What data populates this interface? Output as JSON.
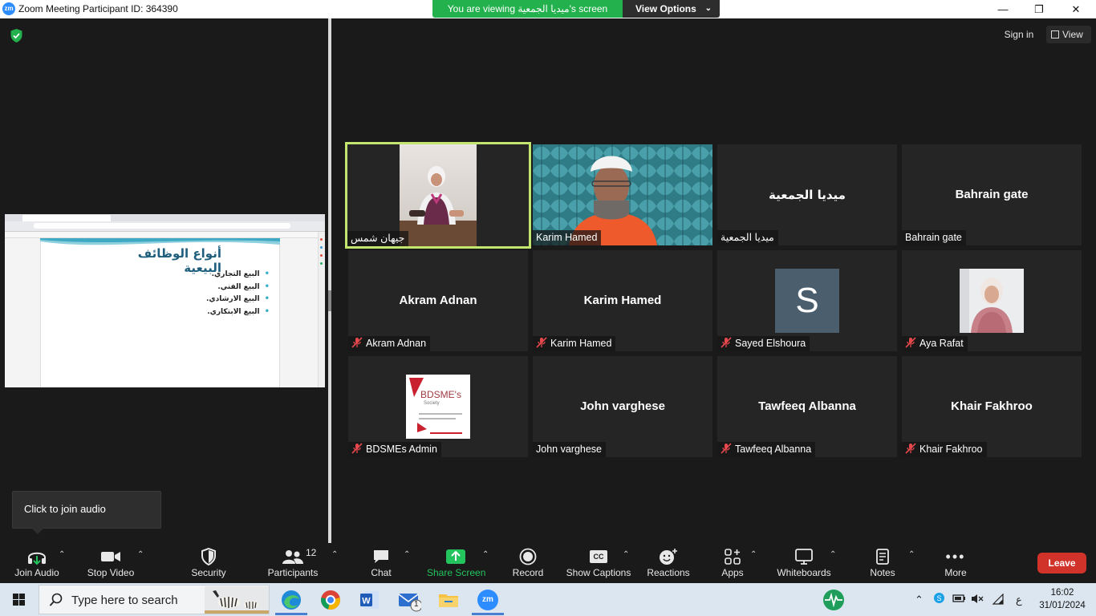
{
  "window": {
    "title": "Zoom Meeting Participant ID: 364390",
    "logo_text": "zm",
    "minimize": "—",
    "restore": "❐",
    "close": "✕"
  },
  "banner": {
    "viewing_text": "You are viewing ميديا الجمعية's screen",
    "view_options": "View Options"
  },
  "header": {
    "sign_in": "Sign in",
    "view": "View"
  },
  "shared_screen": {
    "slide_title": "أنواع الوظائف البيعية",
    "bullets": [
      "البيع التجاري.",
      "البيع الفني.",
      "البيع الارشادي.",
      "البيع الابتكاري."
    ]
  },
  "tiles": [
    {
      "name": "جيهان شمس",
      "display": "",
      "muted": false,
      "type": "video-woman",
      "active": true
    },
    {
      "name": "Karim Hamed",
      "display": "",
      "muted": false,
      "type": "video-man",
      "active": false
    },
    {
      "name": "ميديا الجمعية",
      "display": "ميديا الجمعية",
      "muted": false,
      "type": "name",
      "active": false
    },
    {
      "name": "Bahrain gate",
      "display": "Bahrain gate",
      "muted": false,
      "type": "name",
      "active": false
    },
    {
      "name": "Akram Adnan",
      "display": "Akram Adnan",
      "muted": true,
      "type": "name",
      "active": false
    },
    {
      "name": "Karim Hamed",
      "display": "Karim Hamed",
      "muted": true,
      "type": "name",
      "active": false
    },
    {
      "name": "Sayed Elshoura",
      "display": "S",
      "muted": true,
      "type": "avatar-letter",
      "active": false
    },
    {
      "name": "Aya Rafat",
      "display": "",
      "muted": true,
      "type": "avatar-photo",
      "active": false
    },
    {
      "name": "BDSMEs Admin",
      "display": "",
      "muted": true,
      "type": "avatar-logo",
      "active": false,
      "logo_text": "BDSME's",
      "logo_sub": "Society"
    },
    {
      "name": "John varghese",
      "display": "John varghese",
      "muted": false,
      "type": "name",
      "active": false
    },
    {
      "name": "Tawfeeq Albanna",
      "display": "Tawfeeq Albanna",
      "muted": true,
      "type": "name",
      "active": false
    },
    {
      "name": "Khair Fakhroo",
      "display": "Khair Fakhroo",
      "muted": true,
      "type": "name",
      "active": false
    }
  ],
  "tooltip": "Click to join audio",
  "toolbar": {
    "join_audio": "Join Audio",
    "stop_video": "Stop Video",
    "security": "Security",
    "participants": "Participants",
    "participants_count": "12",
    "chat": "Chat",
    "share_screen": "Share Screen",
    "record": "Record",
    "show_captions": "Show Captions",
    "captions_icon_text": "CC",
    "reactions": "Reactions",
    "apps": "Apps",
    "whiteboards": "Whiteboards",
    "notes": "Notes",
    "more": "More",
    "leave": "Leave"
  },
  "taskbar": {
    "search_placeholder": "Type here to search",
    "zoom_label": "zm",
    "mail_badge": "1",
    "lang": "ع",
    "time": "16:02",
    "date": "31/01/2024"
  },
  "colors": {
    "viewing_banner": "#23b14d",
    "active_speaker_border": "#c3e66e",
    "leave_button": "#d1332b",
    "share_screen_green": "#23c45e",
    "mute_red": "#e5484d",
    "zoom_blue": "#2d8cff"
  }
}
